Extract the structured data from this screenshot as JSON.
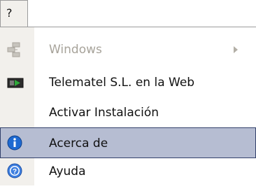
{
  "menubar": {
    "help_label": "?"
  },
  "menu": {
    "items": [
      {
        "label": "Windows",
        "icon": "windows-tree-icon",
        "disabled": true,
        "has_submenu": true
      },
      {
        "label": "Telematel S.L. en la Web",
        "icon": "web-link-icon",
        "disabled": false
      },
      {
        "label": "Activar Instalación",
        "icon": "",
        "disabled": false
      },
      {
        "label": "Acerca de",
        "icon": "info-icon",
        "disabled": false,
        "highlighted": true
      },
      {
        "label": "Ayuda",
        "icon": "help-icon",
        "disabled": false
      }
    ]
  },
  "colors": {
    "highlight_bg": "#b6bdd2",
    "highlight_border": "#33416b",
    "icon_strip_bg": "#f2f0ec",
    "disabled_text": "#a7a39a"
  }
}
